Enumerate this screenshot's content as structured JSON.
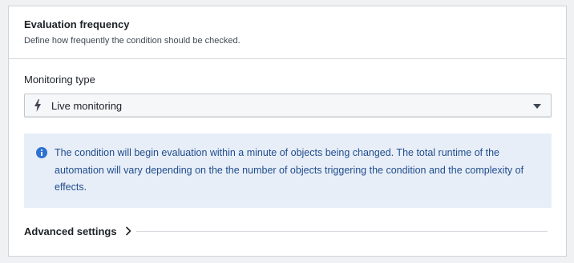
{
  "section": {
    "title": "Evaluation frequency",
    "description": "Define how frequently the condition should be checked."
  },
  "monitoring": {
    "label": "Monitoring type",
    "selected": "Live monitoring",
    "selected_icon": "lightning-bolt-icon"
  },
  "callout": {
    "icon": "info-icon",
    "text": "The condition will begin evaluation within a minute of objects being changed. The total runtime of the automation will vary depending on the the number of objects triggering the condition and the complexity of effects."
  },
  "advanced": {
    "label": "Advanced settings",
    "icon": "chevron-right-icon"
  },
  "colors": {
    "callout_background": "#e8eef8",
    "callout_text": "#1f4d8c",
    "info_icon": "#2d72d2"
  }
}
